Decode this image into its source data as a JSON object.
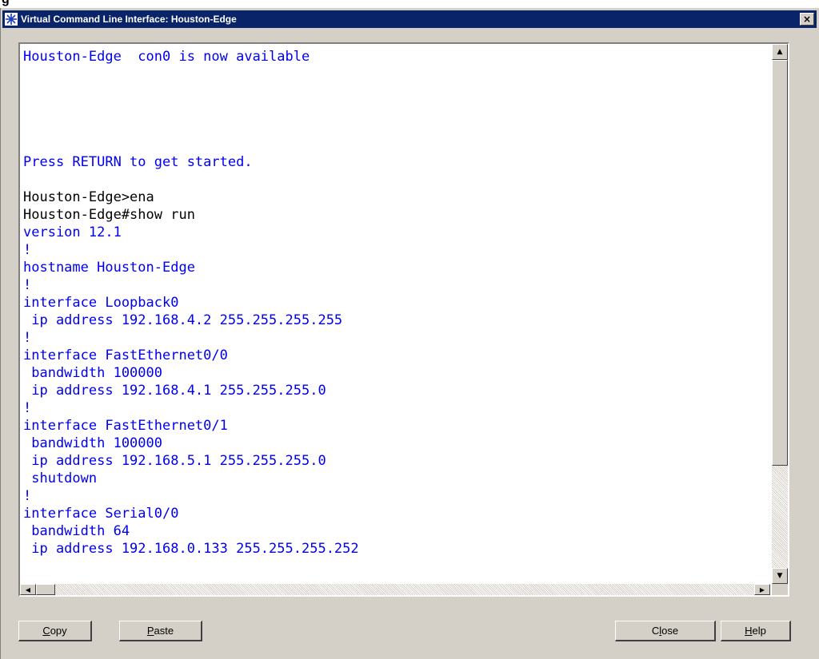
{
  "page": {
    "top_fragment": "g"
  },
  "window": {
    "title": "Virtual Command Line Interface: Houston-Edge",
    "app_icon": "star-burst-icon",
    "close_glyph": "×"
  },
  "terminal": {
    "lines": [
      {
        "text": "Houston-Edge  con0 is now available",
        "kind": "output"
      },
      {
        "text": "",
        "kind": "output"
      },
      {
        "text": "",
        "kind": "output"
      },
      {
        "text": "",
        "kind": "output"
      },
      {
        "text": "",
        "kind": "output"
      },
      {
        "text": "",
        "kind": "output"
      },
      {
        "text": "Press RETURN to get started.",
        "kind": "output"
      },
      {
        "text": "",
        "kind": "output"
      },
      {
        "text": "Houston-Edge>ena",
        "kind": "cmd"
      },
      {
        "text": "Houston-Edge#show run",
        "kind": "cmd"
      },
      {
        "text": "version 12.1",
        "kind": "output"
      },
      {
        "text": "!",
        "kind": "output"
      },
      {
        "text": "hostname Houston-Edge",
        "kind": "output"
      },
      {
        "text": "!",
        "kind": "output"
      },
      {
        "text": "interface Loopback0",
        "kind": "output"
      },
      {
        "text": " ip address 192.168.4.2 255.255.255.255",
        "kind": "output"
      },
      {
        "text": "!",
        "kind": "output"
      },
      {
        "text": "interface FastEthernet0/0",
        "kind": "output"
      },
      {
        "text": " bandwidth 100000",
        "kind": "output"
      },
      {
        "text": " ip address 192.168.4.1 255.255.255.0",
        "kind": "output"
      },
      {
        "text": "!",
        "kind": "output"
      },
      {
        "text": "interface FastEthernet0/1",
        "kind": "output"
      },
      {
        "text": " bandwidth 100000",
        "kind": "output"
      },
      {
        "text": " ip address 192.168.5.1 255.255.255.0",
        "kind": "output"
      },
      {
        "text": " shutdown",
        "kind": "output"
      },
      {
        "text": "!",
        "kind": "output"
      },
      {
        "text": "interface Serial0/0",
        "kind": "output"
      },
      {
        "text": " bandwidth 64",
        "kind": "output"
      },
      {
        "text": " ip address 192.168.0.133 255.255.255.252",
        "kind": "output"
      }
    ]
  },
  "scroll": {
    "up_glyph": "▲",
    "down_glyph": "▼",
    "left_glyph": "◀",
    "right_glyph": "▶"
  },
  "buttons": {
    "copy": {
      "label": "Copy",
      "mnemonic": "C",
      "rest": "opy"
    },
    "paste": {
      "label": "Paste",
      "mnemonic": "P",
      "rest": "aste"
    },
    "close": {
      "label": "Close",
      "pre": "C",
      "mnemonic": "l",
      "rest": "ose"
    },
    "help": {
      "label": "Help",
      "mnemonic": "H",
      "rest": "elp"
    }
  },
  "colors": {
    "titlebar": "#0a246a",
    "output_text": "#0000ee",
    "command_text": "#000000",
    "window_face": "#d4d0c8"
  }
}
